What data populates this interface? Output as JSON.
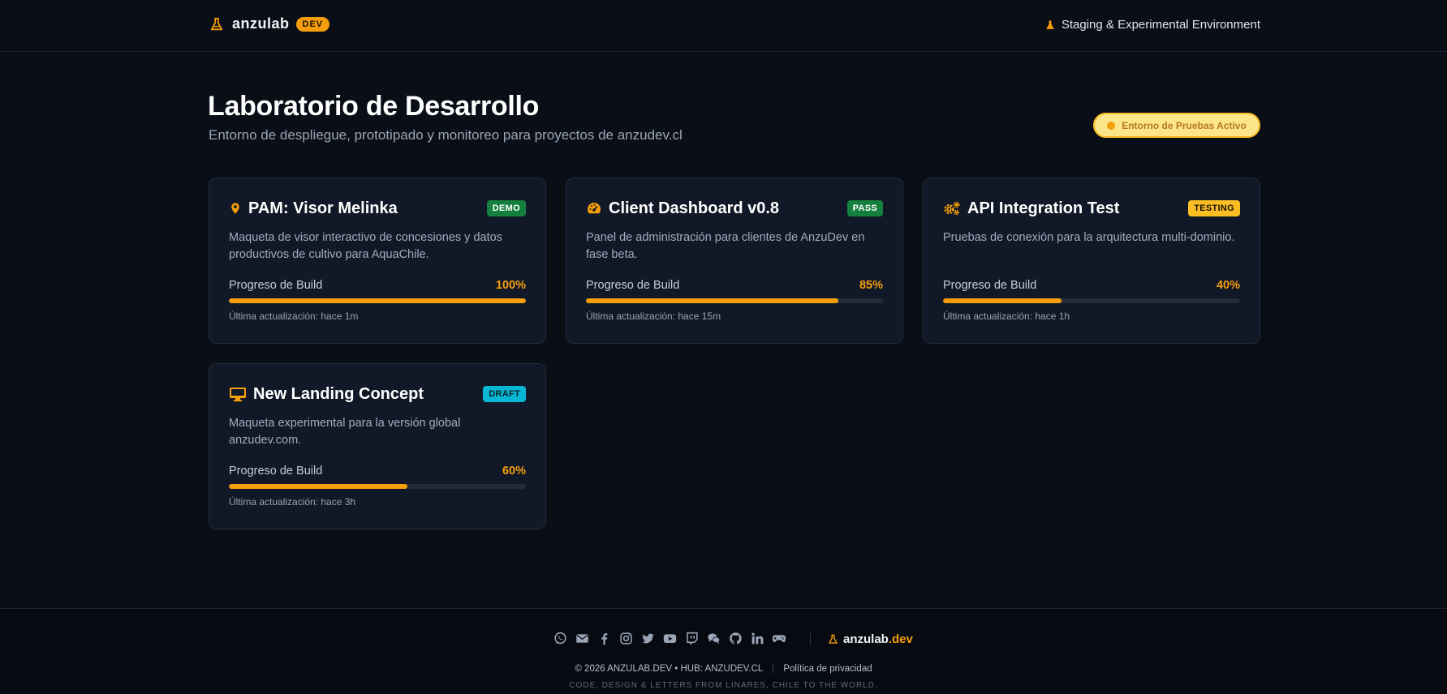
{
  "header": {
    "brand_name": "anzulab",
    "brand_badge": "DEV",
    "environment_label": "Staging & Experimental Environment"
  },
  "hero": {
    "title": "Laboratorio de Desarrollo",
    "subtitle": "Entorno de despliegue, prototipado y monitoreo para proyectos de anzudev.cl",
    "status_pill": "Entorno de Pruebas Activo"
  },
  "colors": {
    "accent": "#f59e0b",
    "background": "#0a0e17",
    "card": "#111827",
    "demo_badge": "#15803d",
    "pass_badge": "#15803d",
    "testing_badge": "#fbbf24",
    "draft_badge": "#06b6d4"
  },
  "projects": [
    {
      "icon": "map-pin-icon",
      "title": "PAM: Visor Melinka",
      "badge": "DEMO",
      "description": "Maqueta de visor interactivo de concesiones y datos productivos de cultivo para AquaChile.",
      "progress_label": "Progreso de Build",
      "progress_text": "100%",
      "progress": 100,
      "updated": "Última actualización: hace 1m"
    },
    {
      "icon": "dashboard-gauge-icon",
      "title": "Client Dashboard v0.8",
      "badge": "PASS",
      "description": "Panel de administración para clientes de AnzuDev en fase beta.",
      "progress_label": "Progreso de Build",
      "progress_text": "85%",
      "progress": 85,
      "updated": "Última actualización: hace 15m"
    },
    {
      "icon": "gears-icon",
      "title": "API Integration Test",
      "badge": "TESTING",
      "description": "Pruebas de conexión para la arquitectura multi-dominio.",
      "progress_label": "Progreso de Build",
      "progress_text": "40%",
      "progress": 40,
      "updated": "Última actualización: hace 1h"
    },
    {
      "icon": "desktop-monitor-icon",
      "title": "New Landing Concept",
      "badge": "DRAFT",
      "description": "Maqueta experimental para la versión global anzudev.com.",
      "progress_label": "Progreso de Build",
      "progress_text": "60%",
      "progress": 60,
      "updated": "Última actualización: hace 3h"
    }
  ],
  "footer": {
    "socials": [
      "whatsapp-icon",
      "email-icon",
      "facebook-icon",
      "instagram-icon",
      "twitter-icon",
      "youtube-icon",
      "twitch-icon",
      "chat-icon",
      "github-icon",
      "linkedin-icon",
      "gamepad-icon"
    ],
    "brand_name": "anzulab",
    "brand_tld": ".dev",
    "copyright": "© 2026 ANZULAB.DEV • HUB: ANZUDEV.CL",
    "privacy_link": "Política de privacidad",
    "tagline": "CODE, DESIGN & LETTERS FROM LINARES, CHILE TO THE WORLD."
  }
}
